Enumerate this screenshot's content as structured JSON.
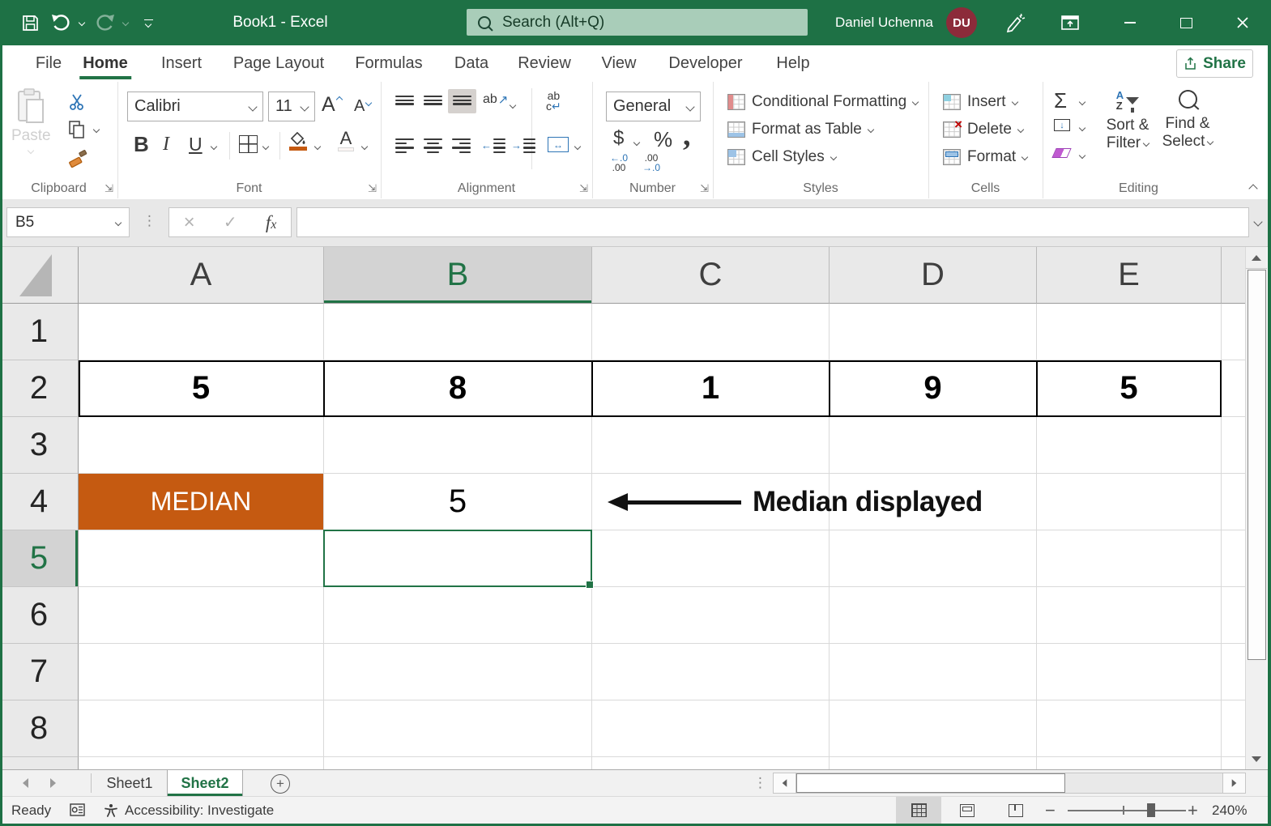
{
  "titlebar": {
    "title": "Book1 - Excel",
    "search_placeholder": "Search (Alt+Q)",
    "user_name": "Daniel Uchenna",
    "user_initials": "DU"
  },
  "ribbon_tabs": {
    "labels": [
      "File",
      "Home",
      "Insert",
      "Page Layout",
      "Formulas",
      "Data",
      "Review",
      "View",
      "Developer",
      "Help"
    ],
    "active": "Home",
    "share": "Share"
  },
  "ribbon": {
    "clipboard": {
      "label": "Clipboard",
      "paste": "Paste"
    },
    "font": {
      "label": "Font",
      "family": "Calibri",
      "size": "11",
      "bold": "B",
      "italic": "I",
      "underline": "U",
      "grow": "A",
      "shrink": "A",
      "color_a": "A"
    },
    "alignment": {
      "label": "Alignment",
      "ab": "ab",
      "c": "c"
    },
    "number": {
      "label": "Number",
      "format": "General",
      "currency": "$",
      "percent": "%",
      "comma": ",",
      "inc_top": "←.0",
      "inc_bottom": ".00",
      "dec_top": ".00",
      "dec_bottom": "→.0"
    },
    "styles": {
      "label": "Styles",
      "conditional_formatting": "Conditional Formatting",
      "format_as_table": "Format as Table",
      "cell_styles": "Cell Styles"
    },
    "cells": {
      "label": "Cells",
      "insert": "Insert",
      "delete": "Delete",
      "format": "Format"
    },
    "editing": {
      "label": "Editing",
      "autosum": "Σ",
      "sort_a": "A",
      "sort_z": "Z",
      "sort_filter_1": "Sort &",
      "sort_filter_2": "Filter",
      "find_select_1": "Find &",
      "find_select_2": "Select"
    }
  },
  "formula_bar": {
    "name_box": "B5",
    "cancel": "×",
    "enter": "✓",
    "fx_f": "f",
    "fx_x": "x",
    "formula": ""
  },
  "grid": {
    "columns": [
      "A",
      "B",
      "C",
      "D",
      "E"
    ],
    "rows": [
      "1",
      "2",
      "3",
      "4",
      "5",
      "6",
      "7",
      "8"
    ],
    "row2_values": [
      "5",
      "8",
      "1",
      "9",
      "5"
    ],
    "median_label": "MEDIAN",
    "median_value": "5",
    "annotation": "Median displayed",
    "selected_cell": "B5"
  },
  "sheet_bar": {
    "tabs": [
      "Sheet1",
      "Sheet2"
    ],
    "active": "Sheet2",
    "new_sheet": "+"
  },
  "status_bar": {
    "mode": "Ready",
    "accessibility": "Accessibility: Investigate",
    "zoom_out": "−",
    "zoom_in": "+",
    "zoom_level": "240%"
  },
  "icons": {
    "wrap_return": "↵",
    "orientation_arrow": "↗",
    "indent_left_arrow": "←",
    "indent_right_arrow": "→",
    "merge_arrows": "↔",
    "fill_down_arrow": "↓",
    "dots": "⋮"
  },
  "colors": {
    "titlebar_green": "#1E7145",
    "accent_green": "#217346",
    "median_orange": "#C55A11",
    "avatar_maroon": "#8C2B3A"
  }
}
